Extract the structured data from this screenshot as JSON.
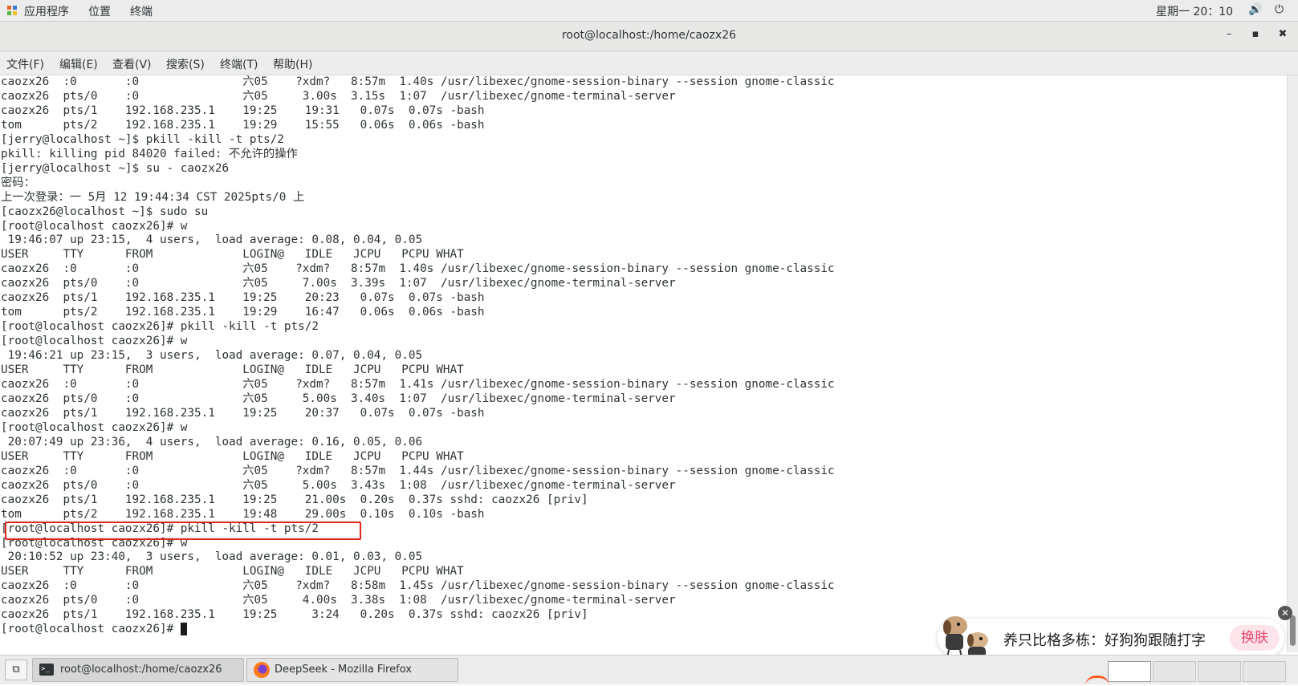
{
  "top_panel": {
    "apps": "应用程序",
    "places": "位置",
    "terminal": "终端",
    "clock": "星期一 20：10",
    "volume_icon": "🔊",
    "power_icon": "⏻"
  },
  "window": {
    "title": "root@localhost:/home/caozx26",
    "minimize": "–",
    "maximize": "▪",
    "close": "✖"
  },
  "menubar": {
    "file": "文件(F)",
    "edit": "编辑(E)",
    "view": "查看(V)",
    "search": "搜索(S)",
    "terminal": "终端(T)",
    "help": "帮助(H)"
  },
  "terminal": {
    "lines": [
      "caozx26  :0       :0               六05    ?xdm?   8:57m  1.40s /usr/libexec/gnome-session-binary --session gnome-classic",
      "caozx26  pts/0    :0               六05     3.00s  3.15s  1:07  /usr/libexec/gnome-terminal-server",
      "caozx26  pts/1    192.168.235.1    19:25    19:31   0.07s  0.07s -bash",
      "tom      pts/2    192.168.235.1    19:29    15:55   0.06s  0.06s -bash",
      "[jerry@localhost ~]$ pkill -kill -t pts/2",
      "pkill: killing pid 84020 failed: 不允许的操作",
      "[jerry@localhost ~]$ su - caozx26",
      "密码：",
      "上一次登录：一 5月 12 19:44:34 CST 2025pts/0 上",
      "[caozx26@localhost ~]$ sudo su",
      "[root@localhost caozx26]# w",
      " 19:46:07 up 23:15,  4 users,  load average: 0.08, 0.04, 0.05",
      "USER     TTY      FROM             LOGIN@   IDLE   JCPU   PCPU WHAT",
      "caozx26  :0       :0               六05    ?xdm?   8:57m  1.40s /usr/libexec/gnome-session-binary --session gnome-classic",
      "caozx26  pts/0    :0               六05     7.00s  3.39s  1:07  /usr/libexec/gnome-terminal-server",
      "caozx26  pts/1    192.168.235.1    19:25    20:23   0.07s  0.07s -bash",
      "tom      pts/2    192.168.235.1    19:29    16:47   0.06s  0.06s -bash",
      "[root@localhost caozx26]# pkill -kill -t pts/2",
      "[root@localhost caozx26]# w",
      " 19:46:21 up 23:15,  3 users,  load average: 0.07, 0.04, 0.05",
      "USER     TTY      FROM             LOGIN@   IDLE   JCPU   PCPU WHAT",
      "caozx26  :0       :0               六05    ?xdm?   8:57m  1.41s /usr/libexec/gnome-session-binary --session gnome-classic",
      "caozx26  pts/0    :0               六05     5.00s  3.40s  1:07  /usr/libexec/gnome-terminal-server",
      "caozx26  pts/1    192.168.235.1    19:25    20:37   0.07s  0.07s -bash",
      "[root@localhost caozx26]# w",
      " 20:07:49 up 23:36,  4 users,  load average: 0.16, 0.05, 0.06",
      "USER     TTY      FROM             LOGIN@   IDLE   JCPU   PCPU WHAT",
      "caozx26  :0       :0               六05    ?xdm?   8:57m  1.44s /usr/libexec/gnome-session-binary --session gnome-classic",
      "caozx26  pts/0    :0               六05     5.00s  3.43s  1:08  /usr/libexec/gnome-terminal-server",
      "caozx26  pts/1    192.168.235.1    19:25    21.00s  0.20s  0.37s sshd: caozx26 [priv]",
      "tom      pts/2    192.168.235.1    19:48    29.00s  0.10s  0.10s -bash",
      "[root@localhost caozx26]# pkill -kill -t pts/2",
      "[root@localhost caozx26]# w",
      " 20:10:52 up 23:40,  3 users,  load average: 0.01, 0.03, 0.05",
      "USER     TTY      FROM             LOGIN@   IDLE   JCPU   PCPU WHAT",
      "caozx26  :0       :0               六05    ?xdm?   8:58m  1.45s /usr/libexec/gnome-session-binary --session gnome-classic",
      "caozx26  pts/0    :0               六05     4.00s  3.38s  1:08  /usr/libexec/gnome-terminal-server",
      "caozx26  pts/1    192.168.235.1    19:25     3:24   0.20s  0.37s sshd: caozx26 [priv]"
    ],
    "prompt": "[root@localhost caozx26]# "
  },
  "ime": {
    "text": "养只比格多栋：好狗狗跟随打字",
    "skin_button": "换肤",
    "close": "✕"
  },
  "taskbar": {
    "show_desktop_icon": "⧉",
    "terminal_task": "root@localhost:/home/caozx26",
    "terminal_icon_text": ">_",
    "firefox_task": "DeepSeek - Mozilla Firefox"
  },
  "colors": {
    "highlight": "#e0261c",
    "skin_button": "#e8446c"
  }
}
